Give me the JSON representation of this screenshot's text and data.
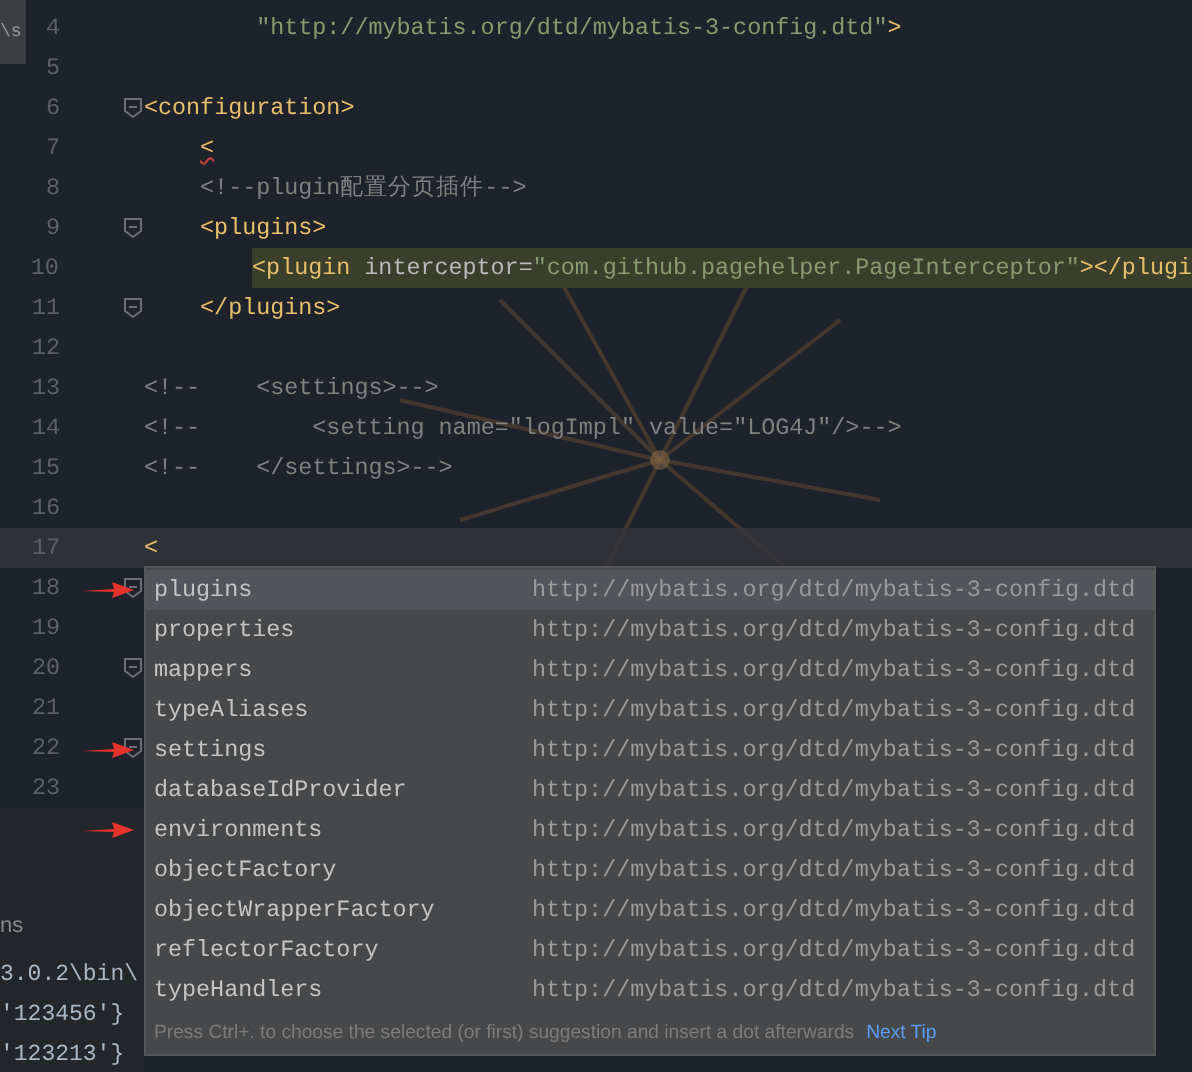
{
  "side_panel": {
    "label": "\\s"
  },
  "editor": {
    "lines": [
      {
        "number": "4",
        "fold": false,
        "current": false,
        "highlighted": false,
        "tokens": [
          {
            "kind": "string",
            "text": "        \"http://mybatis.org/dtd/mybatis-3-config.dtd\""
          },
          {
            "kind": "tag",
            "text": ">"
          }
        ]
      },
      {
        "number": "5",
        "fold": false,
        "current": false,
        "highlighted": false
      },
      {
        "number": "6",
        "fold": true,
        "current": false,
        "highlighted": false,
        "tokens": [
          {
            "kind": "tag",
            "text": "<configuration>"
          }
        ]
      },
      {
        "number": "7",
        "fold": false,
        "current": false,
        "highlighted": false,
        "tokens": [
          {
            "kind": "error",
            "text": "    <"
          }
        ]
      },
      {
        "number": "8",
        "fold": false,
        "current": false,
        "highlighted": false,
        "tokens": [
          {
            "kind": "comment",
            "text": "    <!--plugin配置分页插件-->"
          }
        ]
      },
      {
        "number": "9",
        "fold": true,
        "current": false,
        "highlighted": false,
        "tokens": [
          {
            "kind": "tag",
            "text": "    <plugins>"
          }
        ]
      },
      {
        "number": "10",
        "fold": false,
        "current": false,
        "highlighted": true,
        "tokens": [
          {
            "kind": "tag",
            "text": "        <plugin"
          },
          {
            "kind": "attr",
            "text": " interceptor="
          },
          {
            "kind": "string",
            "text": "\"com.github.pagehelper.PageInterceptor\""
          },
          {
            "kind": "tag",
            "text": "></plugi"
          }
        ]
      },
      {
        "number": "11",
        "fold": true,
        "current": false,
        "highlighted": false,
        "tokens": [
          {
            "kind": "tag",
            "text": "    </plugins>"
          }
        ]
      },
      {
        "number": "12",
        "fold": false,
        "current": false,
        "highlighted": false
      },
      {
        "number": "13",
        "fold": false,
        "current": false,
        "highlighted": false,
        "tokens": [
          {
            "kind": "comment",
            "text": "<!--    <settings>-->"
          }
        ]
      },
      {
        "number": "14",
        "fold": false,
        "current": false,
        "highlighted": false,
        "tokens": [
          {
            "kind": "comment",
            "text": "<!--        <setting name=\"logImpl\" value=\"LOG4J\"/>-->"
          }
        ]
      },
      {
        "number": "15",
        "fold": false,
        "current": false,
        "highlighted": false,
        "tokens": [
          {
            "kind": "comment",
            "text": "<!--    </settings>-->"
          }
        ]
      },
      {
        "number": "16",
        "fold": false,
        "current": false,
        "highlighted": false
      },
      {
        "number": "17",
        "fold": false,
        "current": true,
        "highlighted": false,
        "tokens": [
          {
            "kind": "tag",
            "text": "<"
          }
        ]
      },
      {
        "number": "18",
        "fold": true,
        "current": false,
        "highlighted": false
      },
      {
        "number": "19",
        "fold": false,
        "current": false,
        "highlighted": false
      },
      {
        "number": "20",
        "fold": true,
        "current": false,
        "highlighted": false
      },
      {
        "number": "21",
        "fold": false,
        "current": false,
        "highlighted": false
      },
      {
        "number": "22",
        "fold": true,
        "current": false,
        "highlighted": false
      },
      {
        "number": "23",
        "fold": false,
        "current": false,
        "highlighted": false
      }
    ]
  },
  "console": {
    "tab": "ns",
    "lines": [
      "3.0.2\\bin\\",
      "'123456'}",
      "'123213'}"
    ]
  },
  "completion_popup": {
    "items": [
      {
        "name": "plugins",
        "source": "http://mybatis.org/dtd/mybatis-3-config.dtd",
        "selected": true,
        "arrow": true
      },
      {
        "name": "properties",
        "source": "http://mybatis.org/dtd/mybatis-3-config.dtd",
        "selected": false,
        "arrow": false
      },
      {
        "name": "mappers",
        "source": "http://mybatis.org/dtd/mybatis-3-config.dtd",
        "selected": false,
        "arrow": false
      },
      {
        "name": "typeAliases",
        "source": "http://mybatis.org/dtd/mybatis-3-config.dtd",
        "selected": false,
        "arrow": false
      },
      {
        "name": "settings",
        "source": "http://mybatis.org/dtd/mybatis-3-config.dtd",
        "selected": false,
        "arrow": true
      },
      {
        "name": "databaseIdProvider",
        "source": "http://mybatis.org/dtd/mybatis-3-config.dtd",
        "selected": false,
        "arrow": false
      },
      {
        "name": "environments",
        "source": "http://mybatis.org/dtd/mybatis-3-config.dtd",
        "selected": false,
        "arrow": true
      },
      {
        "name": "objectFactory",
        "source": "http://mybatis.org/dtd/mybatis-3-config.dtd",
        "selected": false,
        "arrow": false
      },
      {
        "name": "objectWrapperFactory",
        "source": "http://mybatis.org/dtd/mybatis-3-config.dtd",
        "selected": false,
        "arrow": false
      },
      {
        "name": "reflectorFactory",
        "source": "http://mybatis.org/dtd/mybatis-3-config.dtd",
        "selected": false,
        "arrow": false
      },
      {
        "name": "typeHandlers",
        "source": "http://mybatis.org/dtd/mybatis-3-config.dtd",
        "selected": false,
        "arrow": false
      }
    ],
    "hint": "Press Ctrl+. to choose the selected (or first) suggestion and insert a dot afterwards",
    "hint_link": "Next Tip"
  }
}
